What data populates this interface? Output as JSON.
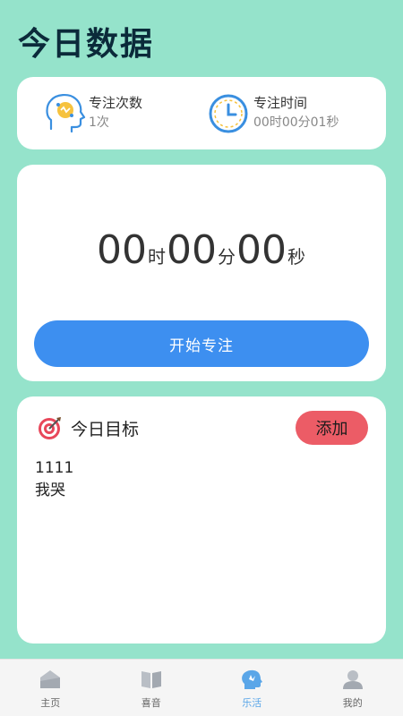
{
  "header": {
    "title": "今日数据"
  },
  "stats": {
    "count": {
      "label": "专注次数",
      "value": "1次",
      "icon": "head-brain-icon"
    },
    "time": {
      "label": "专注时间",
      "value": "00时00分01秒",
      "icon": "clock-icon"
    }
  },
  "timer": {
    "hours": "00",
    "hours_unit": "时",
    "minutes": "00",
    "minutes_unit": "分",
    "seconds": "00",
    "seconds_unit": "秒",
    "start_label": "开始专注"
  },
  "goals": {
    "title": "今日目标",
    "add_label": "添加",
    "items": [
      "1111",
      "我哭"
    ]
  },
  "tabbar": {
    "tabs": [
      {
        "label": "主页",
        "icon": "home-icon"
      },
      {
        "label": "喜音",
        "icon": "book-icon"
      },
      {
        "label": "乐活",
        "icon": "brain-icon",
        "active": true
      },
      {
        "label": "我的",
        "icon": "user-icon"
      }
    ]
  },
  "colors": {
    "background": "#95e3cb",
    "primary": "#3d8ff0",
    "add_button": "#ec5c66",
    "active_tab": "#5aa6e8"
  }
}
